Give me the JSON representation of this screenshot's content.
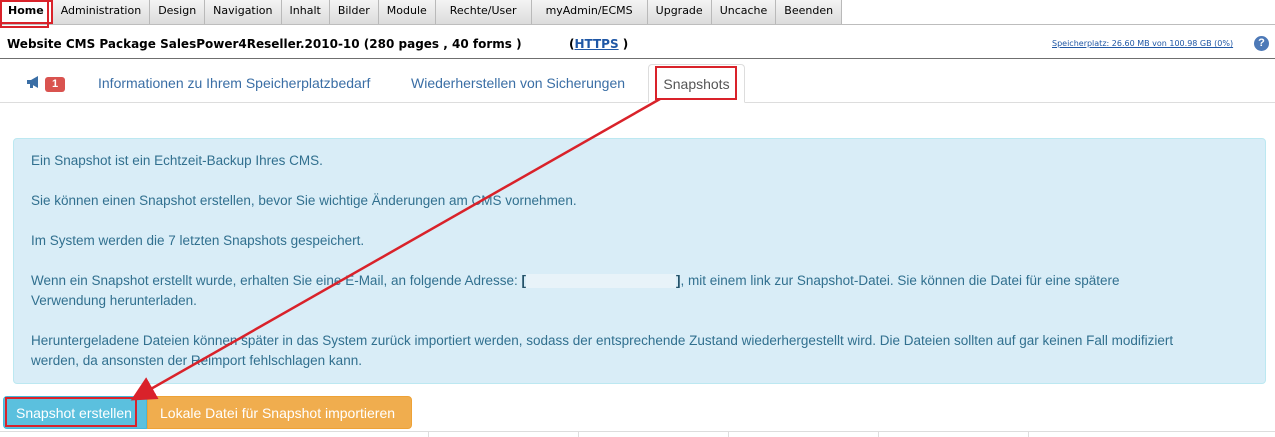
{
  "menu": {
    "items": [
      {
        "label": "Home"
      },
      {
        "label": "Administration"
      },
      {
        "label": "Design"
      },
      {
        "label": "Navigation"
      },
      {
        "label": "Inhalt"
      },
      {
        "label": "Bilder"
      },
      {
        "label": "Module"
      },
      {
        "label": "Rechte/User"
      },
      {
        "label": "myAdmin/ECMS"
      },
      {
        "label": "Upgrade"
      },
      {
        "label": "Uncache"
      },
      {
        "label": "Beenden"
      }
    ]
  },
  "header": {
    "site_title": "Website CMS Package SalesPower4Reseller.2010-10 (280 pages , 40 forms )",
    "https_link": "HTTPS",
    "https_open": "(",
    "https_close": " )",
    "storage": "Speicherplatz: 26.60 MB von 100.98 GB (0%)",
    "help_label": "?"
  },
  "tabs": {
    "badge_count": "1",
    "items": [
      {
        "label": "Informationen zu Ihrem Speicherplatzbedarf"
      },
      {
        "label": "Wiederherstellen von Sicherungen"
      },
      {
        "label": "Snapshots"
      }
    ]
  },
  "info": {
    "p1": "Ein Snapshot ist ein Echtzeit-Backup Ihres CMS.",
    "p2": "Sie können einen Snapshot erstellen, bevor Sie wichtige Änderungen am CMS vornehmen.",
    "p3": "Im System werden die 7 letzten Snapshots gespeichert.",
    "p4_pre": "Wenn ein Snapshot erstellt wurde, erhalten Sie eine E-Mail, an folgende Adresse: ",
    "p4_open": "[",
    "p4_close": "]",
    "p4_post": ", mit einem link zur Snapshot-Datei. Sie können die Datei für eine spätere",
    "p4_line2": "Verwendung herunterladen.",
    "p5_line1": "Heruntergeladene Dateien können später in das System zurück importiert werden, sodass der entsprechende Zustand wiederhergestellt wird. Die Dateien sollten auf gar keinen Fall modifiziert",
    "p5_line2": "werden, da ansonsten der Reimport fehlschlagen kann."
  },
  "buttons": {
    "create": "Snapshot erstellen",
    "import": "Lokale Datei für Snapshot importieren"
  },
  "colors": {
    "annotation": "#d9222a",
    "info_bg": "#d9edf7",
    "info_text": "#31708f",
    "btn_primary": "#5bc0de",
    "btn_warning": "#f0ad4e"
  }
}
